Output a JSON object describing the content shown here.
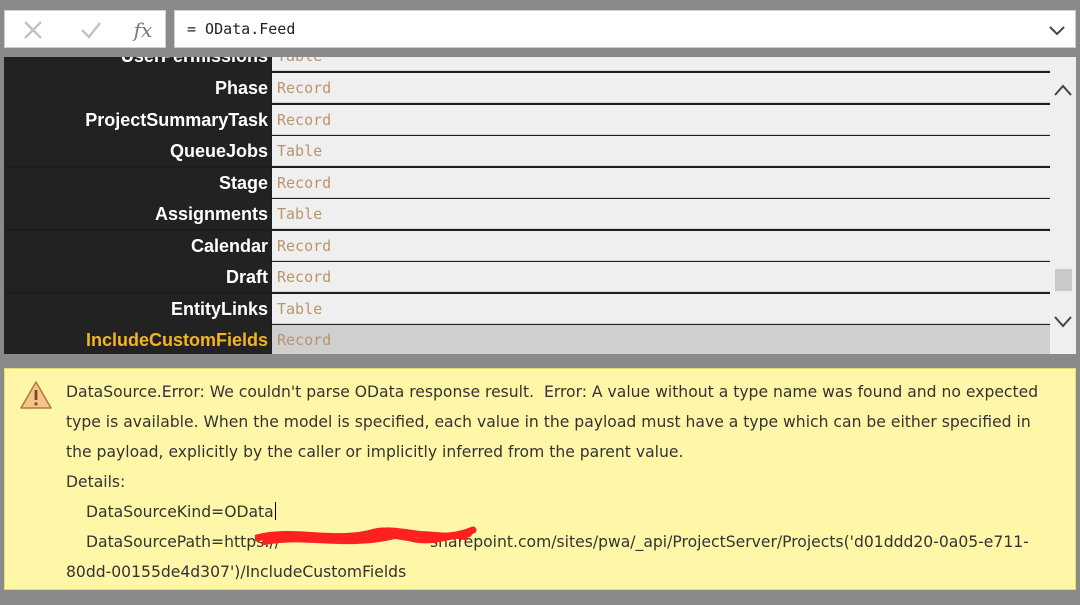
{
  "formula_bar": {
    "cancel_icon": "close-icon",
    "confirm_icon": "checkmark-icon",
    "fx_label": "fx",
    "formula_text": "= OData.Feed",
    "dropdown_icon": "chevron-down-icon"
  },
  "record": {
    "partial_row": {
      "key": "UserPermissions",
      "value": "Table"
    },
    "rows": [
      {
        "key": "Phase",
        "value": "Record"
      },
      {
        "key": "ProjectSummaryTask",
        "value": "Record"
      },
      {
        "key": "QueueJobs",
        "value": "Table"
      },
      {
        "key": "Stage",
        "value": "Record"
      },
      {
        "key": "Assignments",
        "value": "Table"
      },
      {
        "key": "Calendar",
        "value": "Record"
      },
      {
        "key": "Draft",
        "value": "Record"
      },
      {
        "key": "EntityLinks",
        "value": "Table"
      },
      {
        "key": "IncludeCustomFields",
        "value": "Record",
        "selected": true
      }
    ]
  },
  "colors": {
    "selected_key": "#f2b51e",
    "value_text": "#b8956a",
    "error_bg": "#fff7a8"
  },
  "error": {
    "icon": "warning-icon",
    "message_line1": "DataSource.Error: We couldn't parse OData response result.  Error: A value without a type name was found and no expected",
    "message_line2": "type is available. When the model is specified, each value in the payload must have a type which can be either specified in",
    "message_line3": "the payload, explicitly by the caller or implicitly inferred from the parent value.",
    "details_label": "Details:",
    "kind_line": "DataSourceKind=OData",
    "path_line_start": "DataSourcePath=https://",
    "path_line_end": "sharepoint.com/sites/pwa/_api/ProjectServer/Projects('d01ddd20-0a05-e711-",
    "path_line2": "80dd-00155de4d307')/IncludeCustomFields"
  }
}
